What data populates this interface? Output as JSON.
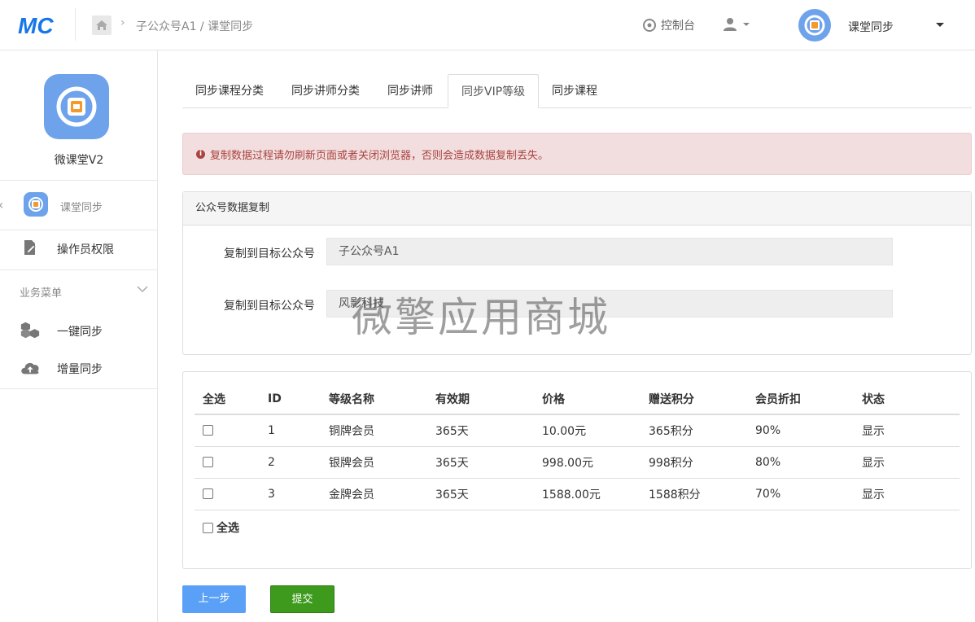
{
  "header": {
    "logo_text": "MC",
    "breadcrumb": "子公众号A1 / 课堂同步",
    "console_label": "控制台",
    "account_name": "课堂同步"
  },
  "sidebar": {
    "app_name": "微课堂V2",
    "module_label": "课堂同步",
    "items": [
      {
        "label": "操作员权限",
        "icon": "document-edit-icon"
      },
      {
        "label": "一键同步",
        "icon": "cubes-icon"
      },
      {
        "label": "增量同步",
        "icon": "cloud-upload-icon"
      }
    ],
    "section_label": "业务菜单"
  },
  "tabs": [
    {
      "label": "同步课程分类",
      "active": false
    },
    {
      "label": "同步讲师分类",
      "active": false
    },
    {
      "label": "同步讲师",
      "active": false
    },
    {
      "label": "同步VIP等级",
      "active": true
    },
    {
      "label": "同步课程",
      "active": false
    }
  ],
  "alert": {
    "text": "复制数据过程请勿刷新页面或者关闭浏览器，否则会造成数据复制丢失。",
    "color": "#a94442"
  },
  "copy_panel": {
    "title": "公众号数据复制",
    "rows": [
      {
        "label": "复制到目标公众号",
        "value": "子公众号A1"
      },
      {
        "label": "复制到目标公众号",
        "value": "风影科技"
      }
    ]
  },
  "watermark": "微擎应用商城",
  "table": {
    "headers": [
      "全选",
      "ID",
      "等级名称",
      "有效期",
      "价格",
      "赠送积分",
      "会员折扣",
      "状态"
    ],
    "rows": [
      [
        "1",
        "铜牌会员",
        "365天",
        "10.00元",
        "365积分",
        "90%",
        "显示"
      ],
      [
        "2",
        "银牌会员",
        "365天",
        "998.00元",
        "998积分",
        "80%",
        "显示"
      ],
      [
        "3",
        "金牌会员",
        "365天",
        "1588.00元",
        "1588积分",
        "70%",
        "显示"
      ]
    ],
    "select_all_label": "全选"
  },
  "buttons": {
    "prev": "上一步",
    "submit": "提交"
  },
  "colors": {
    "accent_blue": "#5aa0f7",
    "submit_green": "#3d9a1c",
    "logo_blue": "#1677e8"
  }
}
